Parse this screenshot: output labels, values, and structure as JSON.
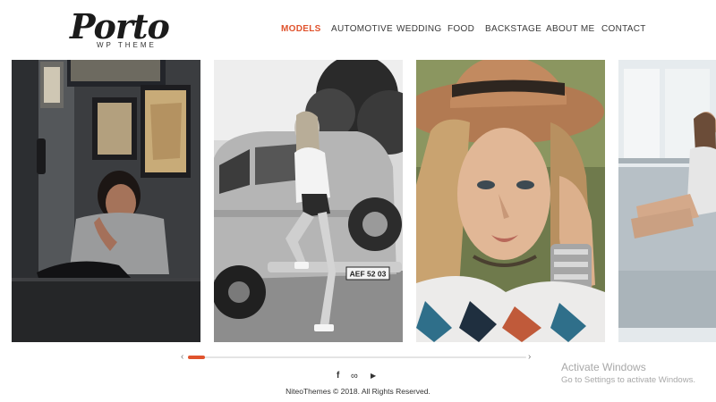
{
  "brand": {
    "logo_text": "Porto",
    "logo_sub": "WP THEME"
  },
  "nav": {
    "items": [
      {
        "label": "MODELS",
        "active": true
      },
      {
        "label": "AUTOMOTIVE"
      },
      {
        "label": "WEDDING"
      },
      {
        "label": "FOOD"
      },
      {
        "label": "BACKSTAGE"
      },
      {
        "label": "ABOUT ME"
      },
      {
        "label": "CONTACT"
      }
    ]
  },
  "gallery": {
    "photos": [
      {
        "subject": "woman-sitting-by-wall-frames"
      },
      {
        "subject": "woman-on-vintage-van",
        "plate": "AEF 52 03"
      },
      {
        "subject": "woman-in-brown-hat"
      },
      {
        "subject": "woman-by-window"
      }
    ]
  },
  "slider": {
    "left_arrow": "‹",
    "right_arrow": "›",
    "progress": 0.05
  },
  "social": {
    "facebook": "f",
    "flickr": "∞",
    "youtube": "▶"
  },
  "footer": {
    "copyright": "NiteoThemes © 2018. All Rights Reserved."
  },
  "watermark": {
    "title": "Activate Windows",
    "subtitle": "Go to Settings to activate Windows."
  },
  "colors": {
    "accent": "#e0532d",
    "text": "#333333"
  }
}
